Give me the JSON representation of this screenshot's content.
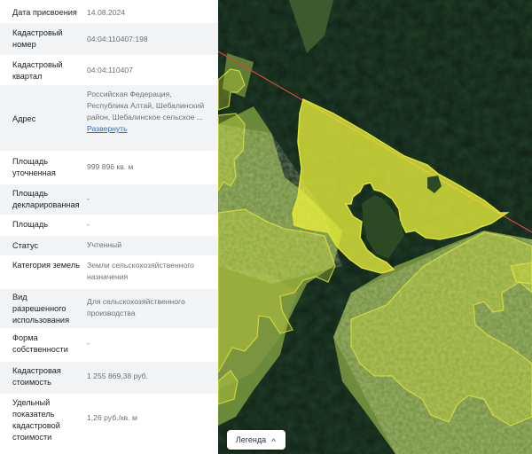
{
  "details": [
    {
      "label": "Дата присвоения",
      "value": "14.08.2024"
    },
    {
      "label": "Кадастровый номер",
      "value": "04:04:110407:198"
    },
    {
      "label": "Кадастровый квартал",
      "value": "04:04:110407"
    },
    {
      "label": "Адрес",
      "value": "Российская Федерация, Республика Алтай, Шебалинский район, Шебалинское сельское ...",
      "link": "Развернуть"
    },
    {
      "label": "Площадь уточненная",
      "value": "999 896 кв. м"
    },
    {
      "label": "Площадь декларированная",
      "value": "-"
    },
    {
      "label": "Площадь",
      "value": "-"
    },
    {
      "label": "Статус",
      "value": "Учтенный"
    },
    {
      "label": "Категория земель",
      "value": "Земли сельскохозяйственного назначения"
    },
    {
      "label": "Вид разрешенного использования",
      "value": "Для сельскохозяйственного производства"
    },
    {
      "label": "Форма собственности",
      "value": "-"
    },
    {
      "label": "Кадастровая стоимость",
      "value": "1 255 869,38 руб."
    },
    {
      "label": "Удельный показатель кадастровой стоимости",
      "value": "1,26 руб./кв. м"
    }
  ],
  "map": {
    "legend_label": "Легенда",
    "colors": {
      "forest": "#1d3b20",
      "meadow": "#6f8a3c",
      "parcel_fill": "#e6ef3a",
      "parcel_stroke": "#d4dc2a",
      "boundary_line": "#d9473a"
    }
  }
}
